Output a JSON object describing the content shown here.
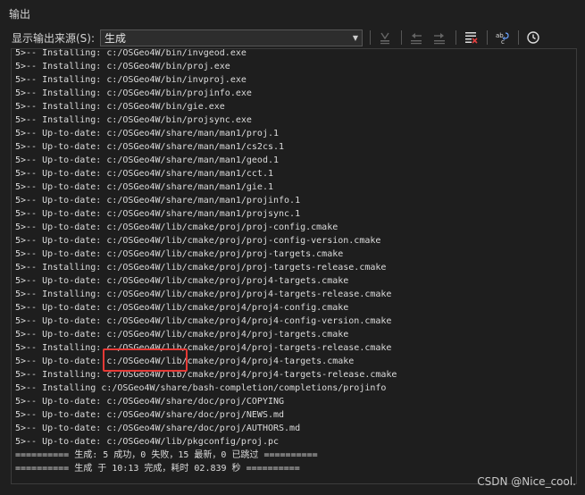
{
  "window": {
    "title": "输出"
  },
  "toolbar": {
    "source_label": "显示输出来源(S):",
    "source_value": "生成",
    "icons": [
      "go-to-error-icon",
      "previous-message-icon",
      "next-message-icon",
      "clear-all-icon",
      "word-wrap-icon",
      "clock-icon"
    ]
  },
  "output": {
    "lines": [
      "5>-- Installing: c:/OSGeo4W/bin/invgeod.exe",
      "5>-- Installing: c:/OSGeo4W/bin/proj.exe",
      "5>-- Installing: c:/OSGeo4W/bin/invproj.exe",
      "5>-- Installing: c:/OSGeo4W/bin/projinfo.exe",
      "5>-- Installing: c:/OSGeo4W/bin/gie.exe",
      "5>-- Installing: c:/OSGeo4W/bin/projsync.exe",
      "5>-- Up-to-date: c:/OSGeo4W/share/man/man1/proj.1",
      "5>-- Up-to-date: c:/OSGeo4W/share/man/man1/cs2cs.1",
      "5>-- Up-to-date: c:/OSGeo4W/share/man/man1/geod.1",
      "5>-- Up-to-date: c:/OSGeo4W/share/man/man1/cct.1",
      "5>-- Up-to-date: c:/OSGeo4W/share/man/man1/gie.1",
      "5>-- Up-to-date: c:/OSGeo4W/share/man/man1/projinfo.1",
      "5>-- Up-to-date: c:/OSGeo4W/share/man/man1/projsync.1",
      "5>-- Up-to-date: c:/OSGeo4W/lib/cmake/proj/proj-config.cmake",
      "5>-- Up-to-date: c:/OSGeo4W/lib/cmake/proj/proj-config-version.cmake",
      "5>-- Up-to-date: c:/OSGeo4W/lib/cmake/proj/proj-targets.cmake",
      "5>-- Installing: c:/OSGeo4W/lib/cmake/proj/proj-targets-release.cmake",
      "5>-- Up-to-date: c:/OSGeo4W/lib/cmake/proj/proj4-targets.cmake",
      "5>-- Installing: c:/OSGeo4W/lib/cmake/proj/proj4-targets-release.cmake",
      "5>-- Up-to-date: c:/OSGeo4W/lib/cmake/proj4/proj4-config.cmake",
      "5>-- Up-to-date: c:/OSGeo4W/lib/cmake/proj4/proj4-config-version.cmake",
      "5>-- Up-to-date: c:/OSGeo4W/lib/cmake/proj4/proj-targets.cmake",
      "5>-- Installing: c:/OSGeo4W/lib/cmake/proj4/proj-targets-release.cmake",
      "5>-- Up-to-date: c:/OSGeo4W/lib/cmake/proj4/proj4-targets.cmake",
      "5>-- Installing: c:/OSGeo4W/lib/cmake/proj4/proj4-targets-release.cmake",
      "5>-- Installing c:/OSGeo4W/share/bash-completion/completions/projinfo",
      "5>-- Up-to-date: c:/OSGeo4W/share/doc/proj/COPYING",
      "5>-- Up-to-date: c:/OSGeo4W/share/doc/proj/NEWS.md",
      "5>-- Up-to-date: c:/OSGeo4W/share/doc/proj/AUTHORS.md",
      "5>-- Up-to-date: c:/OSGeo4W/lib/pkgconfig/proj.pc",
      "========== 生成: 5 成功，0 失败，15 最新，0 已跳过 ==========",
      "========== 生成 于 10:13 完成，耗时 02.839 秒 =========="
    ]
  },
  "watermark": "CSDN @Nice_cool.",
  "colors": {
    "background": "#1e1e1e",
    "text": "#dcdcdc",
    "highlight": "#e53935"
  }
}
